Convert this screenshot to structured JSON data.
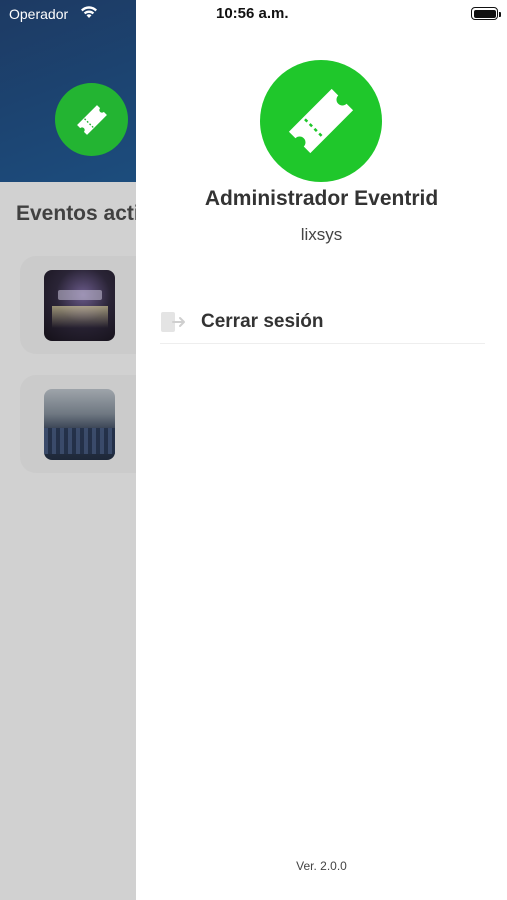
{
  "status_bar": {
    "carrier": "Operador",
    "time": "10:56 a.m."
  },
  "background": {
    "section_title": "Eventos acti",
    "brand_color": "#23b432",
    "header_color": "#1c4a7a"
  },
  "drawer": {
    "name": "Administrador Eventrid",
    "username": "lixsys",
    "logo_color": "#1fc72b",
    "menu": [
      {
        "label": "Cerrar sesión",
        "icon": "logout-icon"
      }
    ],
    "version": "Ver. 2.0.0"
  }
}
